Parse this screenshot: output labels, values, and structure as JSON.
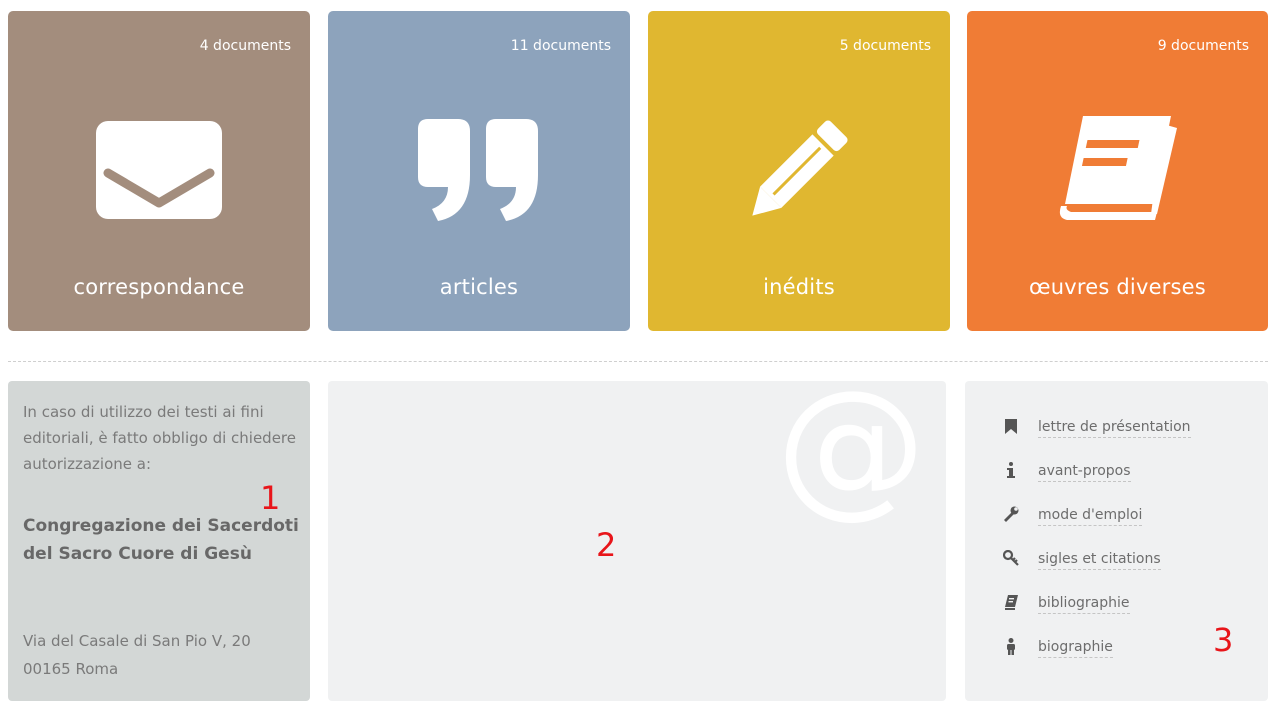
{
  "tiles": [
    {
      "count": "4 documents",
      "label": "correspondance",
      "icon": "envelope-icon",
      "color": "#a38d7d"
    },
    {
      "count": "11 documents",
      "label": "articles",
      "icon": "quote-icon",
      "color": "#8da3bc"
    },
    {
      "count": "5 documents",
      "label": "inédits",
      "icon": "pencil-icon",
      "color": "#e0b730"
    },
    {
      "count": "9 documents",
      "label": "œuvres diverses",
      "icon": "book-icon",
      "color": "#f07c35"
    }
  ],
  "notice": {
    "text": "In caso di utilizzo dei testi ai fini editoriali, è fatto obbligo di chiedere autorizzazione a:",
    "organization": "Congregazione dei Sacerdoti del Sacro Cuore di Gesù",
    "address_line1": "Via del Casale di San Pio V, 20",
    "address_line2": "00165 Roma"
  },
  "contact": {
    "symbol": "@",
    "icon": "at-icon"
  },
  "annotations": {
    "mark1": "1",
    "mark2": "2",
    "mark3": "3",
    "color": "#e8151a"
  },
  "links": [
    {
      "label": "lettre de présentation",
      "icon": "bookmark-icon"
    },
    {
      "label": "avant-propos",
      "icon": "info-icon"
    },
    {
      "label": "mode d'emploi",
      "icon": "wrench-icon"
    },
    {
      "label": "sigles et citations",
      "icon": "key-icon"
    },
    {
      "label": "bibliographie",
      "icon": "book-icon"
    },
    {
      "label": "biographie",
      "icon": "person-icon"
    }
  ]
}
